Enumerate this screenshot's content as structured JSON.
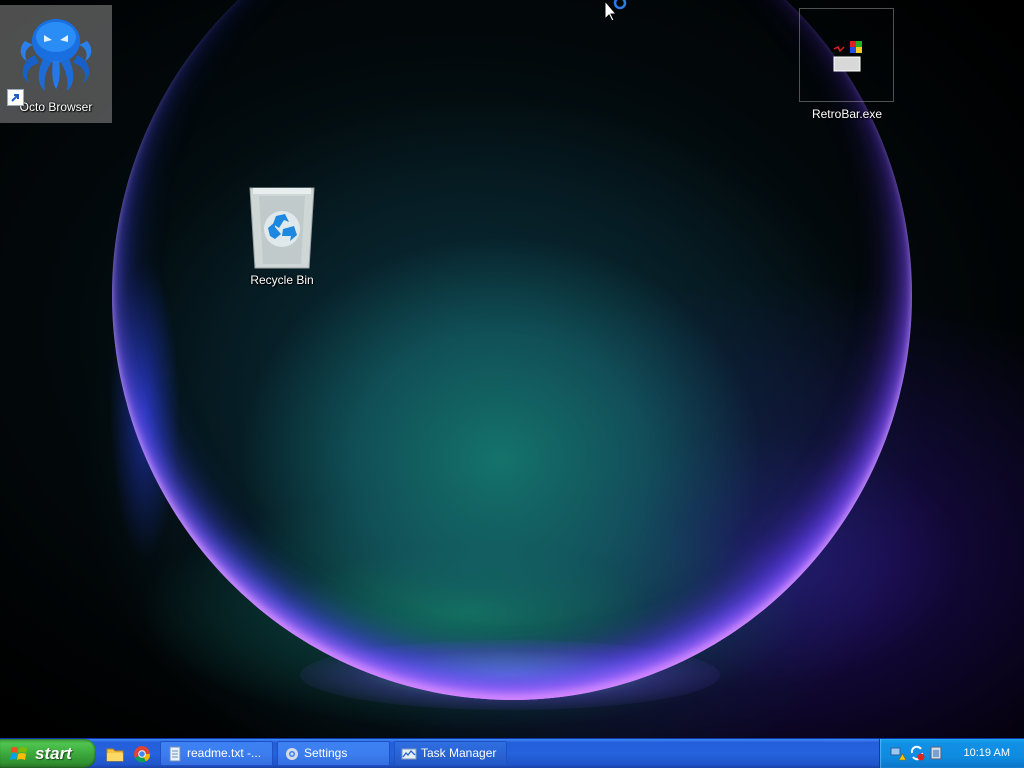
{
  "desktop": {
    "icons": [
      {
        "label": "Octo Browser",
        "icon": "octopus-icon"
      },
      {
        "label": "RetroBar.exe",
        "icon": "retrobar-exe-icon"
      },
      {
        "label": "Recycle Bin",
        "icon": "recycle-bin-icon"
      }
    ]
  },
  "taskbar": {
    "start_label": "start",
    "quick_launch": [
      {
        "icon": "file-explorer-icon"
      },
      {
        "icon": "chrome-icon"
      }
    ],
    "tasks": [
      {
        "label": "readme.txt -...",
        "icon": "notepad-icon"
      },
      {
        "label": "Settings",
        "icon": "settings-gear-icon"
      },
      {
        "label": "Task Manager",
        "icon": "task-manager-icon"
      }
    ],
    "tray": {
      "icons": [
        "network-warning-icon",
        "sync-error-icon",
        "battery-icon"
      ],
      "clock": "10:19 AM"
    }
  },
  "colors": {
    "taskbar_blue": "#245edb",
    "start_green": "#3aa63a",
    "tray_blue": "#0f8ce0"
  }
}
